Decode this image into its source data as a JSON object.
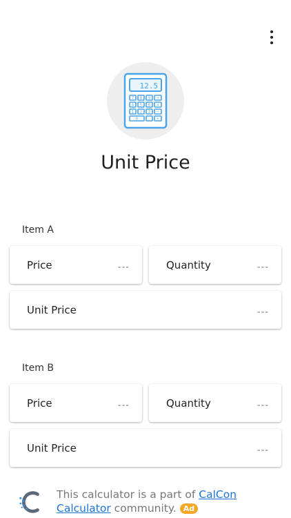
{
  "header": {
    "menu_icon": "more-vert-icon",
    "hero_icon": "calculator-icon",
    "calculator_display": "12.5",
    "title": "Unit Price"
  },
  "item_a": {
    "label": "Item A",
    "price": {
      "label": "Price",
      "value": "---"
    },
    "quantity": {
      "label": "Quantity",
      "value": "---"
    },
    "unit_price": {
      "label": "Unit Price",
      "value": "---"
    }
  },
  "item_b": {
    "label": "Item B",
    "price": {
      "label": "Price",
      "value": "---"
    },
    "quantity": {
      "label": "Quantity",
      "value": "---"
    },
    "unit_price": {
      "label": "Unit Price",
      "value": "---"
    }
  },
  "footer": {
    "logo_icon": "calcon-logo-icon",
    "text_before": "This calculator is a part of ",
    "link_1": "CalCon",
    "link_2": "Calculator",
    "text_after": " community. ",
    "ad_label": "Ad"
  },
  "colors": {
    "accent": "#1e73d8",
    "icon_blue": "#4aa3e8",
    "ad_badge": "#f5a623",
    "hero_bg": "#eeeeee"
  }
}
